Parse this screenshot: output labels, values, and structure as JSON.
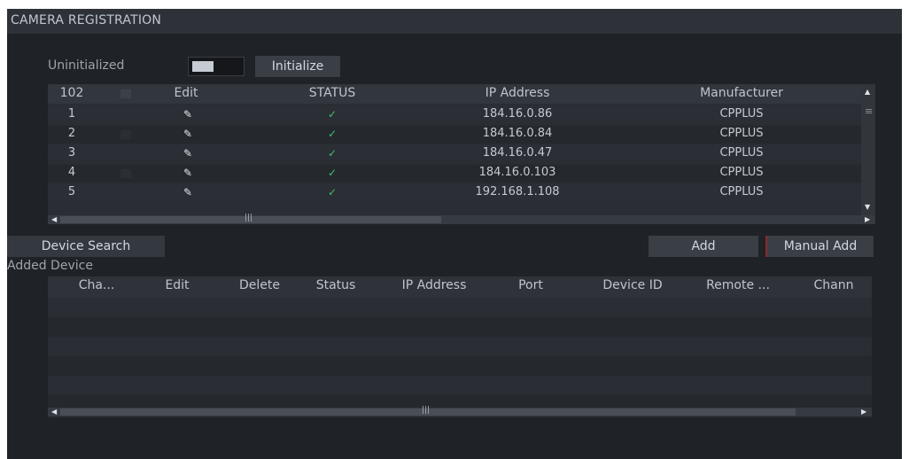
{
  "window": {
    "title": "CAMERA REGISTRATION"
  },
  "uninit": {
    "label": "Uninitialized",
    "initialize_label": "Initialize"
  },
  "top_table": {
    "headers": [
      "102",
      "Edit",
      "STATUS",
      "IP Address",
      "Manufacturer"
    ],
    "rows": [
      {
        "no": "1",
        "ip": "184.16.0.86",
        "manufacturer": "CPPLUS"
      },
      {
        "no": "2",
        "ip": "184.16.0.84",
        "manufacturer": "CPPLUS"
      },
      {
        "no": "3",
        "ip": "184.16.0.47",
        "manufacturer": "CPPLUS"
      },
      {
        "no": "4",
        "ip": "184.16.0.103",
        "manufacturer": "CPPLUS"
      },
      {
        "no": "5",
        "ip": "192.168.1.108",
        "manufacturer": "CPPLUS"
      }
    ]
  },
  "actions": {
    "device_search": "Device Search",
    "add": "Add",
    "manual_add": "Manual Add"
  },
  "added": {
    "title": "Added Device",
    "headers": [
      "Cha...",
      "Edit",
      "Delete",
      "Status",
      "IP Address",
      "Port",
      "Device ID",
      "Remote ...",
      "Chann"
    ]
  },
  "icons": {
    "edit": "pencil-icon",
    "status": "checkmark-icon",
    "scroll_handle": "grip-icon"
  },
  "colors": {
    "background": "#1f2227",
    "status_ok": "#3fbf6c"
  }
}
